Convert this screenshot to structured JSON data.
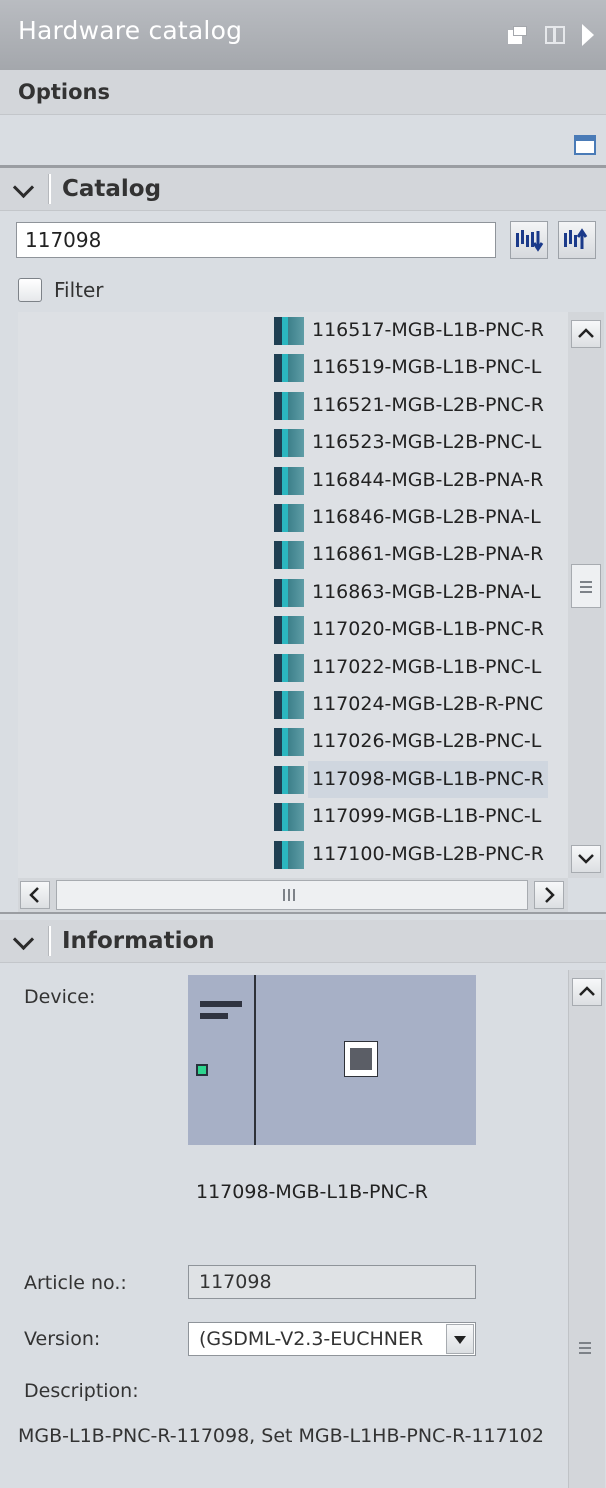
{
  "header": {
    "title": "Hardware catalog"
  },
  "options": {
    "label": "Options"
  },
  "catalog": {
    "label": "Catalog",
    "search_value": "117098",
    "filter_label": "Filter",
    "items": [
      {
        "label": "116517-MGB-L1B-PNC-R",
        "selected": false
      },
      {
        "label": "116519-MGB-L1B-PNC-L",
        "selected": false
      },
      {
        "label": "116521-MGB-L2B-PNC-R",
        "selected": false
      },
      {
        "label": "116523-MGB-L2B-PNC-L",
        "selected": false
      },
      {
        "label": "116844-MGB-L2B-PNA-R",
        "selected": false
      },
      {
        "label": "116846-MGB-L2B-PNA-L",
        "selected": false
      },
      {
        "label": "116861-MGB-L2B-PNA-R",
        "selected": false
      },
      {
        "label": "116863-MGB-L2B-PNA-L",
        "selected": false
      },
      {
        "label": "117020-MGB-L1B-PNC-R",
        "selected": false
      },
      {
        "label": "117022-MGB-L1B-PNC-L",
        "selected": false
      },
      {
        "label": "117024-MGB-L2B-R-PNC",
        "selected": false
      },
      {
        "label": "117026-MGB-L2B-PNC-L",
        "selected": false
      },
      {
        "label": "117098-MGB-L1B-PNC-R",
        "selected": true
      },
      {
        "label": "117099-MGB-L1B-PNC-L",
        "selected": false
      },
      {
        "label": "117100-MGB-L2B-PNC-R",
        "selected": false
      }
    ]
  },
  "information": {
    "label": "Information",
    "device_label": "Device:",
    "device_name": "117098-MGB-L1B-PNC-R",
    "article_label": "Article no.:",
    "article_value": "117098",
    "version_label": "Version:",
    "version_value": "(GSDML-V2.3-EUCHNER",
    "description_label": "Description:",
    "description_text": "MGB-L1B-PNC-R-117098, Set MGB-L1HB-PNC-R-117102"
  },
  "icons": [
    "float-icon",
    "split-icon",
    "collapse-arrow-icon",
    "panel-icon",
    "chevron-down-icon",
    "search-down-icon",
    "search-up-icon",
    "module-icon",
    "scroll-up-icon",
    "scroll-down-icon",
    "scroll-left-icon",
    "scroll-right-icon",
    "dropdown-arrow-icon"
  ]
}
